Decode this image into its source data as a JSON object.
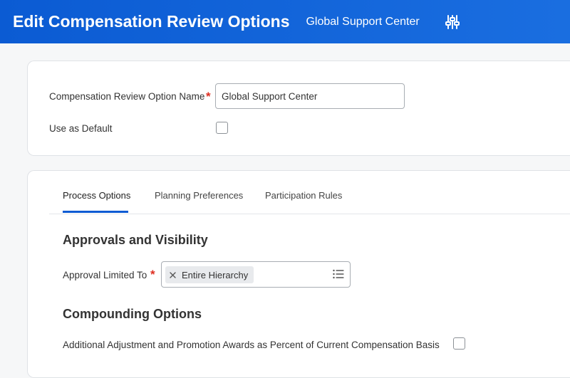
{
  "header": {
    "title": "Edit Compensation Review Options",
    "subtitle": "Global Support Center",
    "settings_icon": "sliders-icon",
    "background": "#0b5bd3"
  },
  "form": {
    "name_label": "Compensation Review Option Name",
    "name_value": "Global Support Center",
    "default_label": "Use as Default",
    "default_checked": false,
    "required_mark": "*"
  },
  "tabs": [
    {
      "label": "Process Options",
      "active": true
    },
    {
      "label": "Planning Preferences",
      "active": false
    },
    {
      "label": "Participation Rules",
      "active": false
    }
  ],
  "approvals": {
    "section_title": "Approvals and Visibility",
    "limited_label": "Approval Limited To",
    "selected_item": "Entire Hierarchy"
  },
  "compounding": {
    "section_title": "Compounding Options",
    "adjustment_label": "Additional Adjustment and Promotion Awards as Percent of Current Compensation Basis",
    "adjustment_checked": false
  },
  "colors": {
    "accent": "#0b5bd3",
    "required": "#de2e21"
  }
}
